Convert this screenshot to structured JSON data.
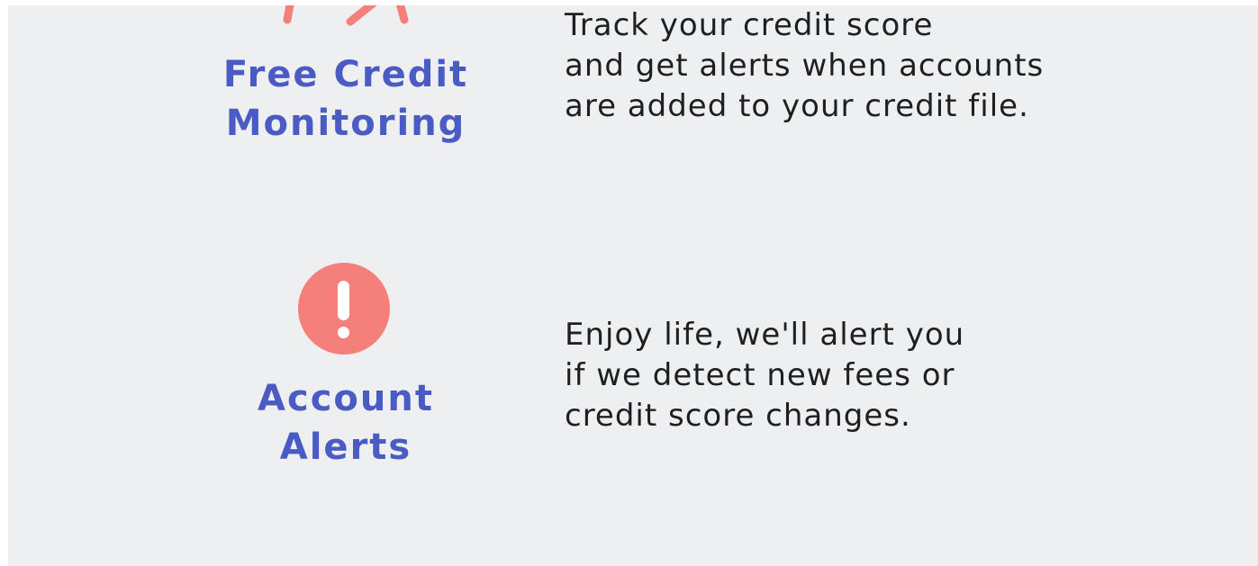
{
  "features": [
    {
      "icon": "credit-score-gauge-icon",
      "title_line1": "Free Credit",
      "title_line2": "Monitoring",
      "desc_line1": "Track your credit score",
      "desc_line2": "and get alerts when accounts",
      "desc_line3": "are added to your credit file."
    },
    {
      "icon": "exclamation-alert-icon",
      "title_line1": "Account",
      "title_line2": "Alerts",
      "desc_line1": "Enjoy life, we'll alert you",
      "desc_line2": "if we detect new fees or",
      "desc_line3": "credit score changes."
    }
  ],
  "colors": {
    "background": "#eeeff1",
    "accent_title": "#4a5cc4",
    "icon_coral": "#f5807b",
    "body_text": "#1f1f1f"
  }
}
